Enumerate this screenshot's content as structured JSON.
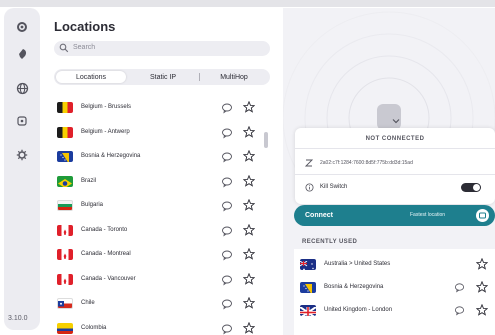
{
  "app": {
    "version": "3.10.0"
  },
  "sidebar": {
    "icons": [
      "gear-icon",
      "rocket-icon",
      "globe-icon",
      "network-icon",
      "settings-icon"
    ]
  },
  "locations": {
    "title": "Locations",
    "search_placeholder": "Search",
    "tabs": [
      {
        "label": "Locations",
        "active": true
      },
      {
        "label": "Static IP",
        "active": false
      },
      {
        "label": "MultiHop",
        "active": false
      }
    ],
    "items": [
      {
        "label": "Belgium - Brussels",
        "flag": "be"
      },
      {
        "label": "Belgium - Antwerp",
        "flag": "be"
      },
      {
        "label": "Bosnia & Herzegovina",
        "flag": "ba"
      },
      {
        "label": "Brazil",
        "flag": "br"
      },
      {
        "label": "Bulgaria",
        "flag": "bg"
      },
      {
        "label": "Canada - Toronto",
        "flag": "ca"
      },
      {
        "label": "Canada - Montreal",
        "flag": "ca"
      },
      {
        "label": "Canada - Vancouver",
        "flag": "ca"
      },
      {
        "label": "Chile",
        "flag": "cl"
      },
      {
        "label": "Colombia",
        "flag": "co"
      }
    ]
  },
  "connection": {
    "status": "NOT CONNECTED",
    "ip_address": "2a02:c7f:1284:7600:8d5f:775b:dd3d:15ad",
    "kill_switch_label": "Kill Switch",
    "kill_switch_on": true,
    "connect_label": "Connect",
    "connect_sublabel": "Fastest location"
  },
  "recently_used": {
    "title": "RECENTLY USED",
    "items": [
      {
        "label": "Australia > United States",
        "flag": "au"
      },
      {
        "label": "Bosnia & Herzegovina",
        "flag": "ba"
      },
      {
        "label": "United Kingdom - London",
        "flag": "gb"
      }
    ]
  },
  "colors": {
    "accent": "#1e7f8e",
    "text": "#2c2c35",
    "panel": "#f2f2f6"
  }
}
